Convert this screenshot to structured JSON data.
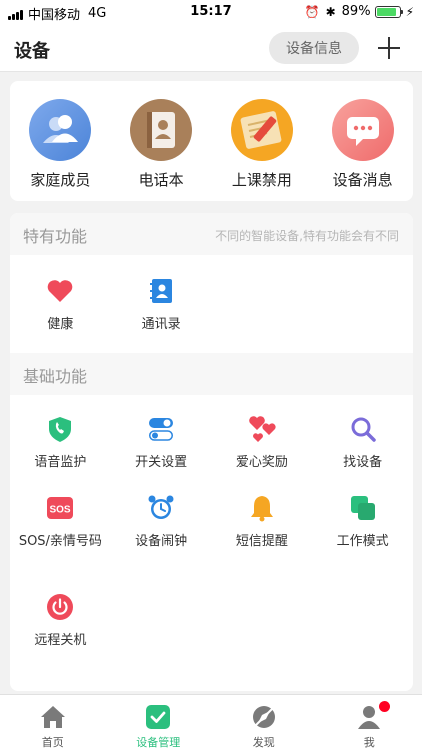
{
  "status_bar": {
    "carrier": "中国移动",
    "network": "4G",
    "time": "15:17",
    "battery": "89%"
  },
  "nav": {
    "title": "设备",
    "device_info_label": "设备信息"
  },
  "top_items": [
    {
      "label": "家庭成员",
      "icon": "family-members-icon"
    },
    {
      "label": "电话本",
      "icon": "phonebook-icon"
    },
    {
      "label": "上课禁用",
      "icon": "class-disable-icon"
    },
    {
      "label": "设备消息",
      "icon": "device-message-icon"
    }
  ],
  "special": {
    "title": "特有功能",
    "note": "不同的智能设备,特有功能会有不同",
    "items": [
      {
        "label": "健康",
        "icon": "heart-icon"
      },
      {
        "label": "通讯录",
        "icon": "contacts-icon"
      }
    ]
  },
  "basic": {
    "title": "基础功能",
    "items": [
      {
        "label": "语音监护",
        "icon": "voice-monitor-icon"
      },
      {
        "label": "开关设置",
        "icon": "toggle-settings-icon"
      },
      {
        "label": "爱心奖励",
        "icon": "love-reward-icon"
      },
      {
        "label": "找设备",
        "icon": "find-device-icon"
      },
      {
        "label": "SOS/亲情号码",
        "icon": "sos-icon"
      },
      {
        "label": "设备闹钟",
        "icon": "alarm-clock-icon"
      },
      {
        "label": "短信提醒",
        "icon": "sms-reminder-icon"
      },
      {
        "label": "工作模式",
        "icon": "work-mode-icon"
      },
      {
        "label": "远程关机",
        "icon": "remote-shutdown-icon"
      }
    ]
  },
  "tabs": [
    {
      "label": "首页",
      "icon": "home-icon"
    },
    {
      "label": "设备管理",
      "icon": "device-manage-icon"
    },
    {
      "label": "发现",
      "icon": "discover-icon"
    },
    {
      "label": "我",
      "icon": "profile-icon"
    }
  ],
  "colors": {
    "accent": "#2bbf7e",
    "red": "#ef4a5a",
    "blue": "#2b86e0",
    "orange": "#f5a623"
  }
}
